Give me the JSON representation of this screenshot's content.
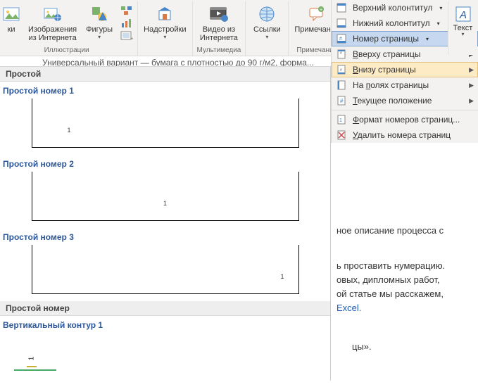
{
  "ribbon": {
    "pictures": {
      "label": "ки",
      "icon": "image-icon"
    },
    "online_pics": {
      "label1": "Изображения",
      "label2": "из Интернета"
    },
    "shapes": {
      "label": "Фигуры"
    },
    "group_illustrations": "Иллюстрации",
    "addins": {
      "label": "Надстройки"
    },
    "online_video": {
      "label1": "Видео из",
      "label2": "Интернета"
    },
    "group_multimedia": "Мультимедиа",
    "links": {
      "label": "Ссылки"
    },
    "comment": {
      "label": "Примечание"
    },
    "group_comments": "Примечания",
    "header": {
      "label": "Верхний колонтитул"
    },
    "footer": {
      "label": "Нижний колонтитул"
    },
    "pagenum": {
      "label": "Номер страницы"
    },
    "textbox": {
      "label": "Текст"
    }
  },
  "pagenum_menu": {
    "top": "Вверху страницы",
    "bottom": "Внизу страницы",
    "margins": "На полях страницы",
    "current": "Текущее положение",
    "format": "Формат номеров страниц...",
    "remove": "Удалить номера страниц"
  },
  "gallery": {
    "section_simple": "Простой",
    "item1": "Простой номер 1",
    "item2": "Простой номер 2",
    "item3": "Простой номер 3",
    "section_simple2": "Простой номер",
    "vertical1": "Вертикальный контур 1",
    "one": "1"
  },
  "doc": {
    "truncated_top": "Универсальный вариант — бумага с плотностью до 90 г/м2, форма...",
    "frag1": "ное описание процесса с",
    "frag2": "ь проставить нумерацию.",
    "frag3": "овых,  дипломных  работ,",
    "frag4": "ой статье мы расскажем,",
    "frag5": "Excel.",
    "frag6": "цы»."
  },
  "accent": "#2b579a"
}
